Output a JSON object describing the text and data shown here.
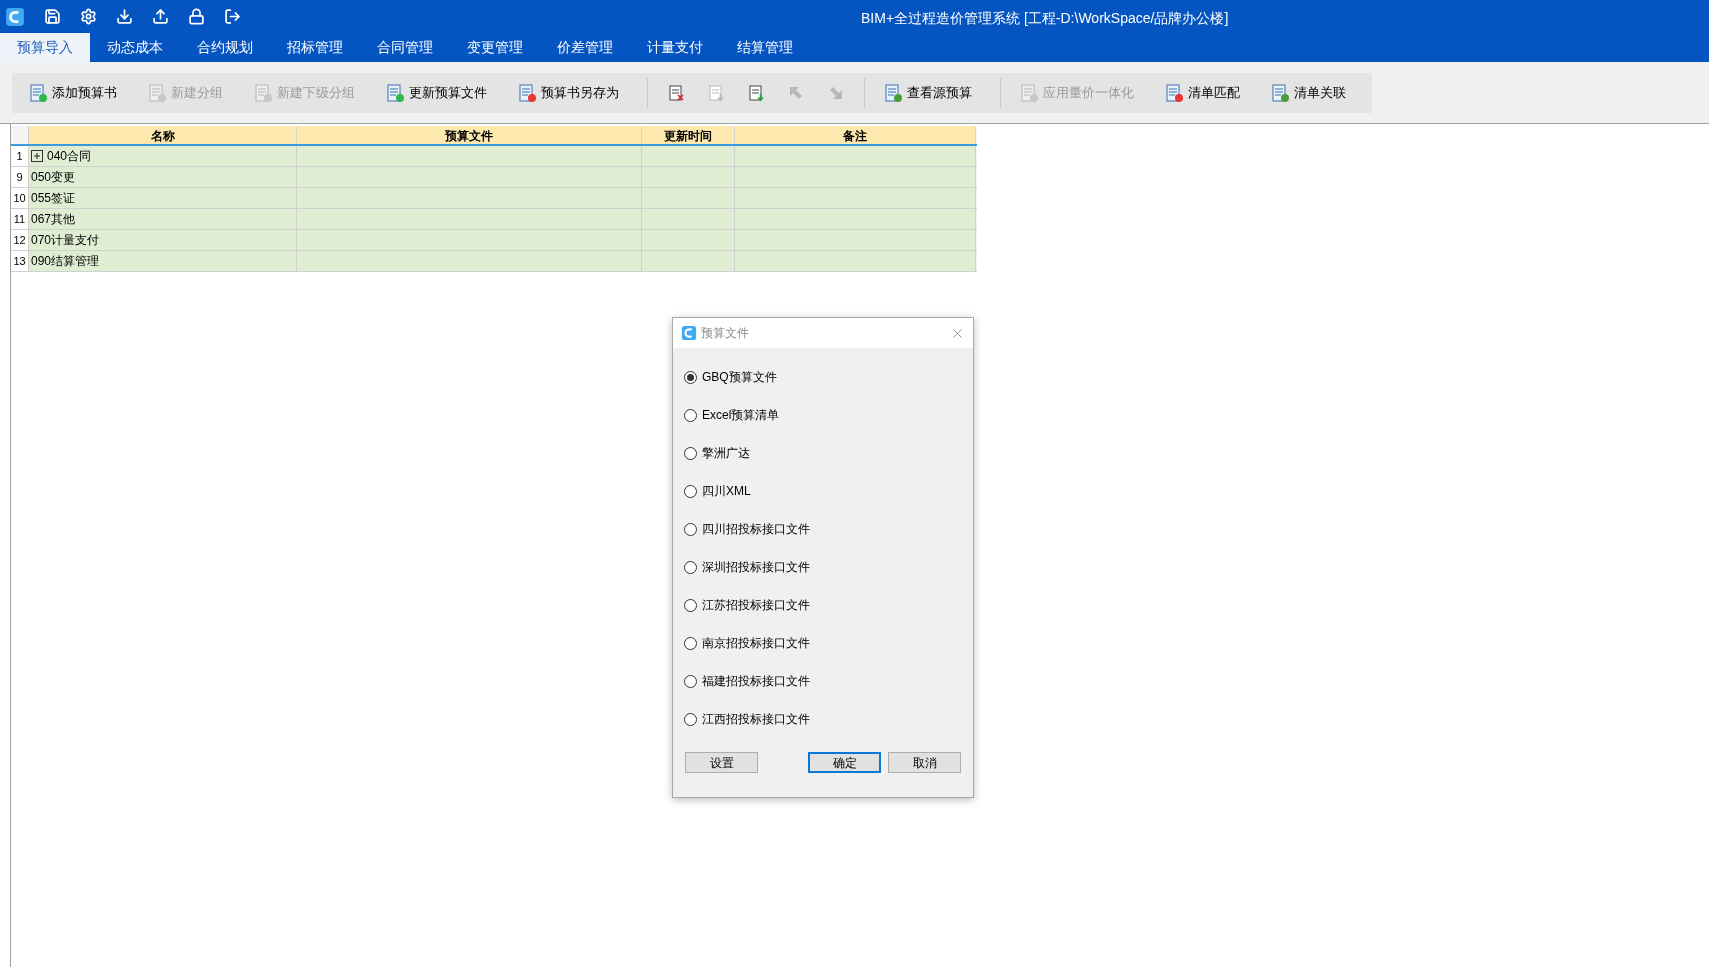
{
  "window": {
    "title": "BIM+全过程造价管理系统 [工程-D:\\WorkSpace/品牌办公楼]"
  },
  "tabs": [
    {
      "label": "预算导入",
      "selected": true
    },
    {
      "label": "动态成本",
      "selected": false
    },
    {
      "label": "合约规划",
      "selected": false
    },
    {
      "label": "招标管理",
      "selected": false
    },
    {
      "label": "合同管理",
      "selected": false
    },
    {
      "label": "变更管理",
      "selected": false
    },
    {
      "label": "价差管理",
      "selected": false
    },
    {
      "label": "计量支付",
      "selected": false
    },
    {
      "label": "结算管理",
      "selected": false
    }
  ],
  "toolbar": [
    {
      "kind": "button",
      "label": "添加预算书",
      "disabled": false
    },
    {
      "kind": "button",
      "label": "新建分组",
      "disabled": true
    },
    {
      "kind": "button",
      "label": "新建下级分组",
      "disabled": true
    },
    {
      "kind": "button",
      "label": "更新预算文件",
      "disabled": false
    },
    {
      "kind": "button",
      "label": "预算书另存为",
      "disabled": false
    },
    {
      "kind": "separator"
    },
    {
      "kind": "icon",
      "disabled": false
    },
    {
      "kind": "icon",
      "disabled": true
    },
    {
      "kind": "icon",
      "disabled": false
    },
    {
      "kind": "icon",
      "disabled": true
    },
    {
      "kind": "icon",
      "disabled": true
    },
    {
      "kind": "separator"
    },
    {
      "kind": "button",
      "label": "查看源预算",
      "disabled": false
    },
    {
      "kind": "separator"
    },
    {
      "kind": "button",
      "label": "应用量价一体化",
      "disabled": true
    },
    {
      "kind": "button",
      "label": "清单匹配",
      "disabled": false
    },
    {
      "kind": "button",
      "label": "清单关联",
      "disabled": false
    }
  ],
  "table": {
    "columns": [
      "名称",
      "预算文件",
      "更新时间",
      "备注"
    ],
    "rows": [
      {
        "number": "1",
        "name": "040合同",
        "expanded": false
      },
      {
        "number": "9",
        "name": "050变更"
      },
      {
        "number": "10",
        "name": "055签证"
      },
      {
        "number": "11",
        "name": "067其他"
      },
      {
        "number": "12",
        "name": "070计量支付"
      },
      {
        "number": "13",
        "name": "090结算管理"
      }
    ]
  },
  "dialog": {
    "title": "预算文件",
    "options": [
      {
        "label": "GBQ预算文件",
        "selected": true
      },
      {
        "label": "Excel预算清单",
        "selected": false
      },
      {
        "label": "擎洲广达",
        "selected": false
      },
      {
        "label": "四川XML",
        "selected": false
      },
      {
        "label": "四川招投标接口文件",
        "selected": false
      },
      {
        "label": "深圳招投标接口文件",
        "selected": false
      },
      {
        "label": "江苏招投标接口文件",
        "selected": false
      },
      {
        "label": "南京招投标接口文件",
        "selected": false
      },
      {
        "label": "福建招投标接口文件",
        "selected": false
      },
      {
        "label": "江西招投标接口文件",
        "selected": false
      }
    ],
    "buttons": [
      {
        "label": "设置",
        "focused": false
      },
      {
        "label": "确定",
        "focused": true
      },
      {
        "label": "取消",
        "focused": false
      }
    ]
  }
}
